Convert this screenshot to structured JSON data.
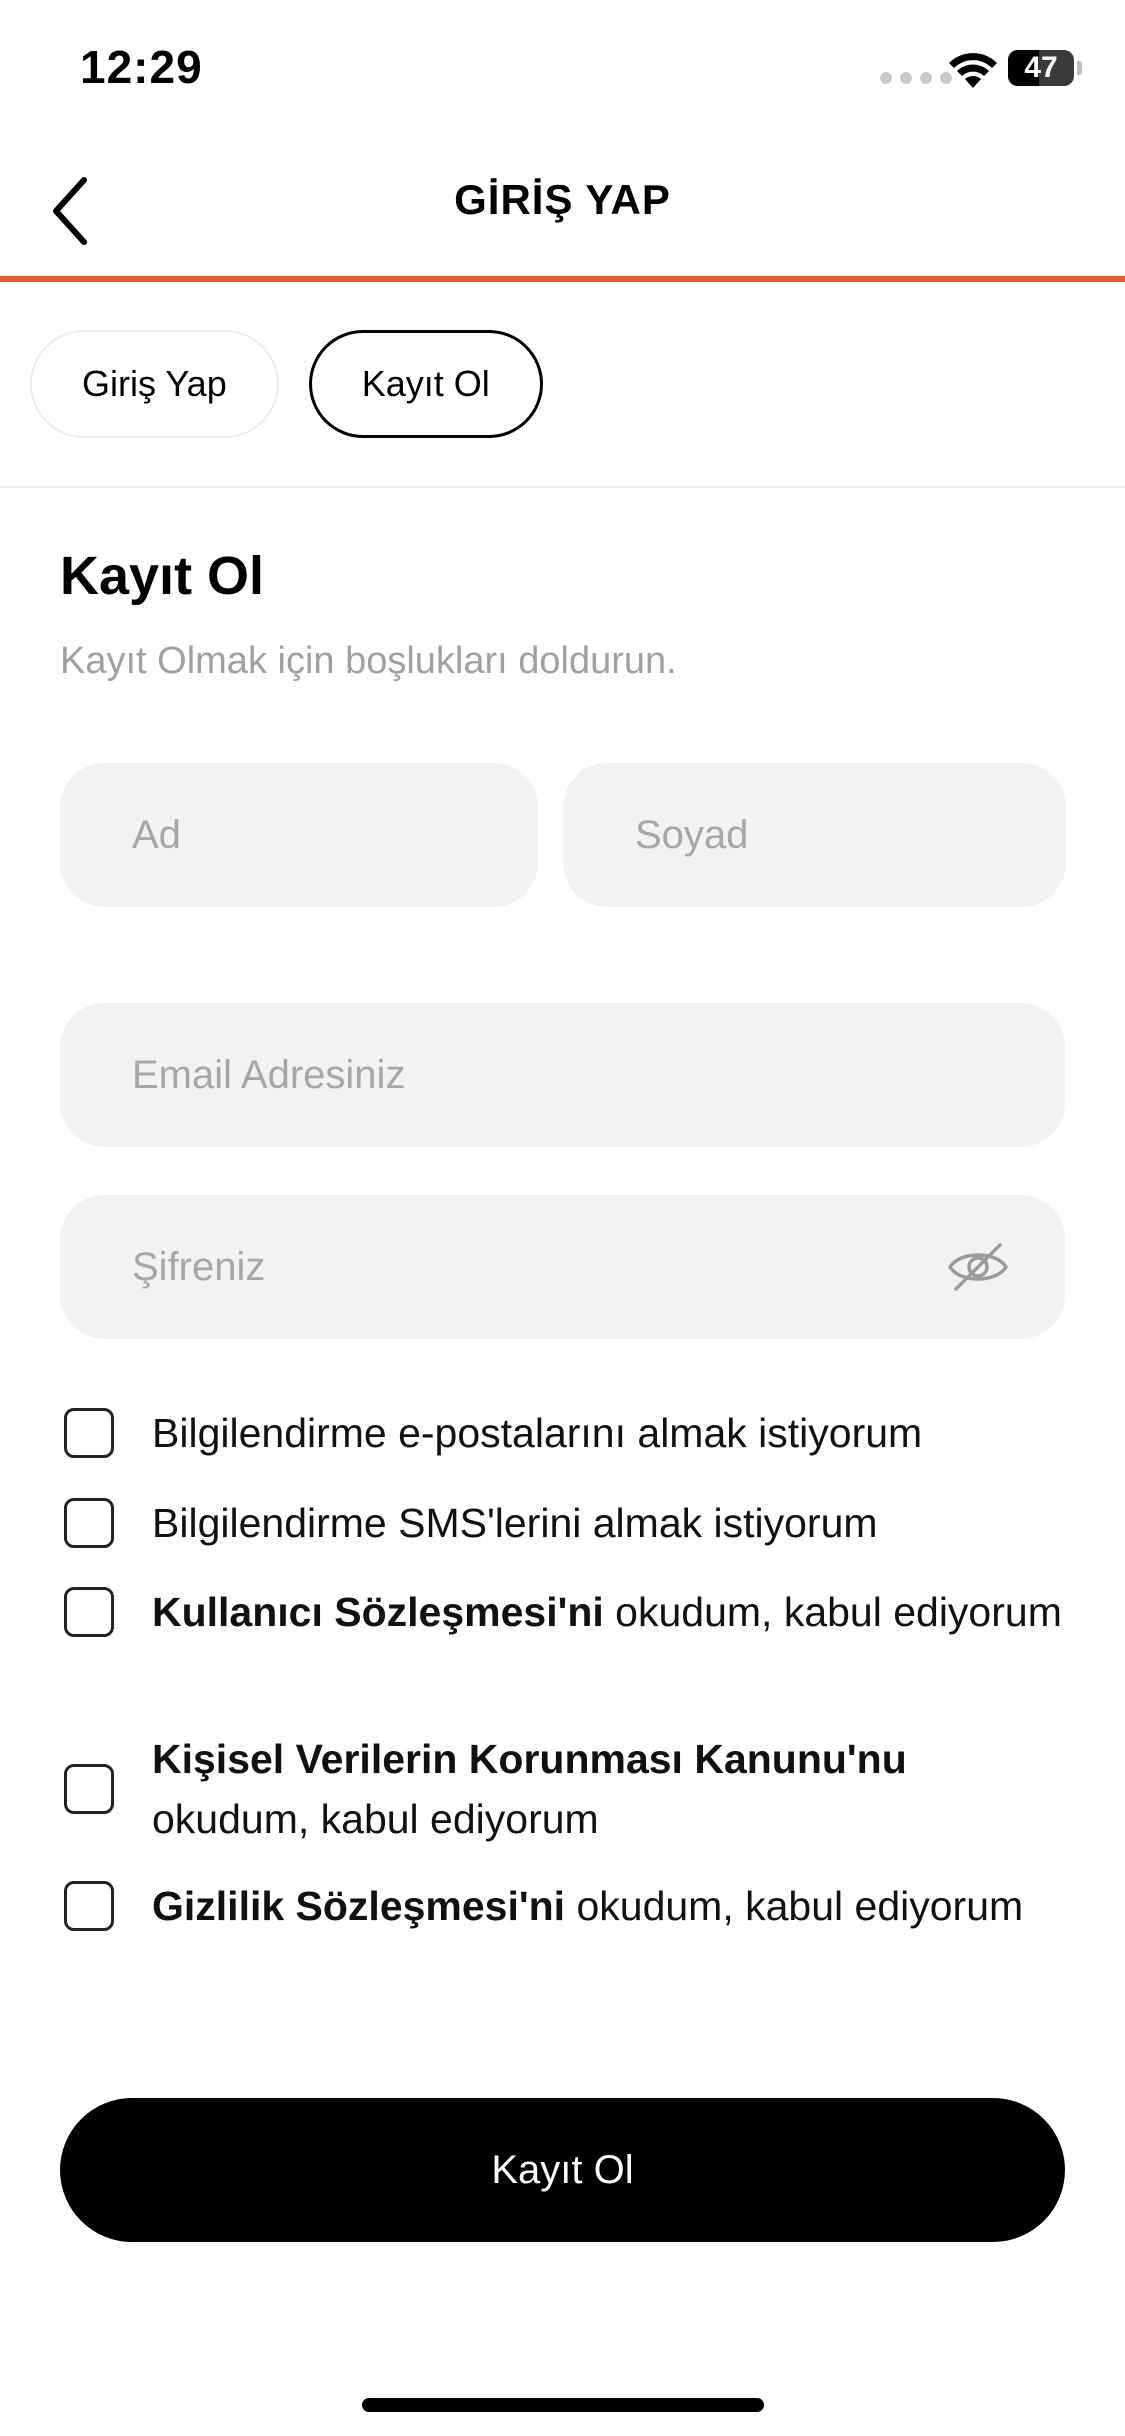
{
  "status_bar": {
    "time": "12:29",
    "battery": "47",
    "battery_level": 0.47
  },
  "header": {
    "title": "GİRİŞ YAP"
  },
  "tabs": [
    {
      "label": "Giriş Yap",
      "active": false
    },
    {
      "label": "Kayıt Ol",
      "active": true
    }
  ],
  "form": {
    "title": "Kayıt Ol",
    "subtitle": "Kayıt Olmak için boşlukları doldurun.",
    "first_name": {
      "placeholder": "Ad",
      "value": ""
    },
    "last_name": {
      "placeholder": "Soyad",
      "value": ""
    },
    "email": {
      "placeholder": "Email Adresiniz",
      "value": ""
    },
    "password": {
      "placeholder": "Şifreniz",
      "value": ""
    },
    "password_toggle_icon": "eye-slash-icon"
  },
  "consents": [
    {
      "bold": "",
      "text": "Bilgilendirme e-postalarını almak istiyorum",
      "checked": false
    },
    {
      "bold": "",
      "text": "Bilgilendirme SMS'lerini almak istiyorum",
      "checked": false
    },
    {
      "bold": "Kullanıcı Sözleşmesi'ni",
      "text": " okudum, kabul ediyorum",
      "checked": false
    },
    {
      "bold": "Kişisel Verilerin Korunması Kanunu'nu",
      "text": " okudum, kabul ediyorum",
      "checked": false
    },
    {
      "bold": "Gizlilik Sözleşmesi'ni",
      "text": " okudum, kabul ediyorum",
      "checked": false
    }
  ],
  "submit": {
    "label": "Kayıt Ol"
  },
  "colors": {
    "accent": "#e35a2b",
    "field_bg": "#f2f2f2",
    "placeholder": "#a6a6a6",
    "primary": "#000000"
  }
}
